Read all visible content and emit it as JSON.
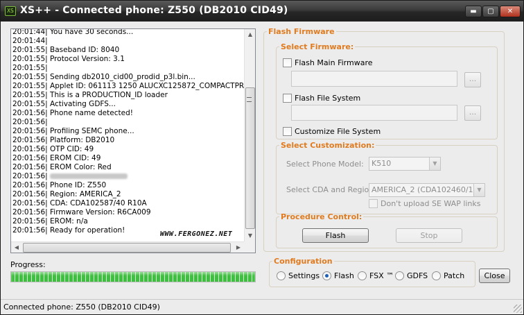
{
  "window": {
    "title": "XS++ - Connected phone: Z550 (DB2010 CID49)",
    "app_icon_text": "XS",
    "controls": {
      "minimize": "▬",
      "maximize": "▢",
      "close": "✕"
    }
  },
  "log": {
    "lines": [
      "20:01:44| You have 30 seconds...",
      "20:01:44|",
      "20:01:55| Baseband ID: 8040",
      "20:01:55| Protocol Version: 3.1",
      "20:01:55|",
      "20:01:55| Sending db2010_cid00_prodid_p3l.bin...",
      "20:01:55| Applet ID: 061113 1250 ALUCXC125872_COMPACTPRODU",
      "20:01:55| This is a PRODUCTION_ID loader",
      "20:01:55| Activating GDFS...",
      "20:01:56| Phone name detected!",
      "20:01:56|",
      "20:01:56| Profiling SEMC phone...",
      "20:01:56| Platform: DB2010",
      "20:01:56| OTP CID: 49",
      "20:01:56| EROM CID: 49",
      "20:01:56| EROM Color: Red",
      "20:01:56|",
      "20:01:56| Phone ID: Z550",
      "20:01:56| Region: AMERICA_2",
      "20:01:56| CDA: CDA102587/40   R10A",
      "20:01:56| Firmware Version: R6CA009",
      "20:01:56| EROM: n/a",
      "20:01:56| Ready for operation!"
    ],
    "watermark": "WWW.FERGONEZ.NET"
  },
  "progress": {
    "label": "Progress:",
    "value_percent": 100
  },
  "flash_firmware": {
    "legend": "Flash Firmware",
    "select_firmware": {
      "legend": "Select Firmware:",
      "main_firmware_label": "Flash Main Firmware",
      "file_system_label": "Flash File System",
      "customize_label": "Customize File System",
      "browse_label": "..."
    },
    "select_customization": {
      "legend": "Select Customization:",
      "phone_model_label": "Select Phone Model:",
      "phone_model_value": "K510",
      "cda_region_label": "Select CDA and Region:",
      "cda_region_value": "AMERICA_2 (CDA102460/101)",
      "no_upload_label": "Don't upload SE WAP links"
    },
    "procedure_control": {
      "legend": "Procedure Control:",
      "flash_button": "Flash",
      "stop_button": "Stop"
    }
  },
  "configuration": {
    "legend": "Configuration",
    "options": [
      "Settings",
      "Flash",
      "FSX ™",
      "GDFS",
      "Patch"
    ],
    "selected": "Flash"
  },
  "close_button": "Close",
  "status": {
    "text": "Connected phone: Z550 (DB2010 CID49)"
  }
}
